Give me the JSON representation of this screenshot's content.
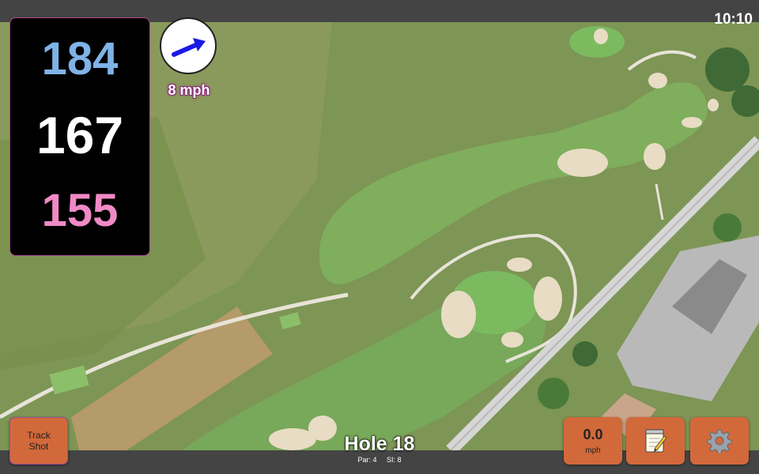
{
  "status": {
    "time": "10:10"
  },
  "distances": {
    "back": "184",
    "middle": "167",
    "front": "155"
  },
  "wind": {
    "speed_label": "8 mph",
    "direction_icon": "wind-arrow-icon",
    "arrow_color": "#1a1ae6"
  },
  "hole": {
    "title": "Hole 18",
    "par": "Par: 4",
    "stroke_index": "SI: 8"
  },
  "buttons": {
    "track_shot_line1": "Track",
    "track_shot_line2": "Shot",
    "speed_value": "0.0",
    "speed_unit": "mph",
    "notes_icon": "notepad-icon",
    "settings_icon": "gear-icon"
  },
  "colors": {
    "back_distance": "#7fb3e8",
    "middle_distance": "#ffffff",
    "front_distance": "#f08ac6",
    "button_accent": "#d2693a"
  }
}
